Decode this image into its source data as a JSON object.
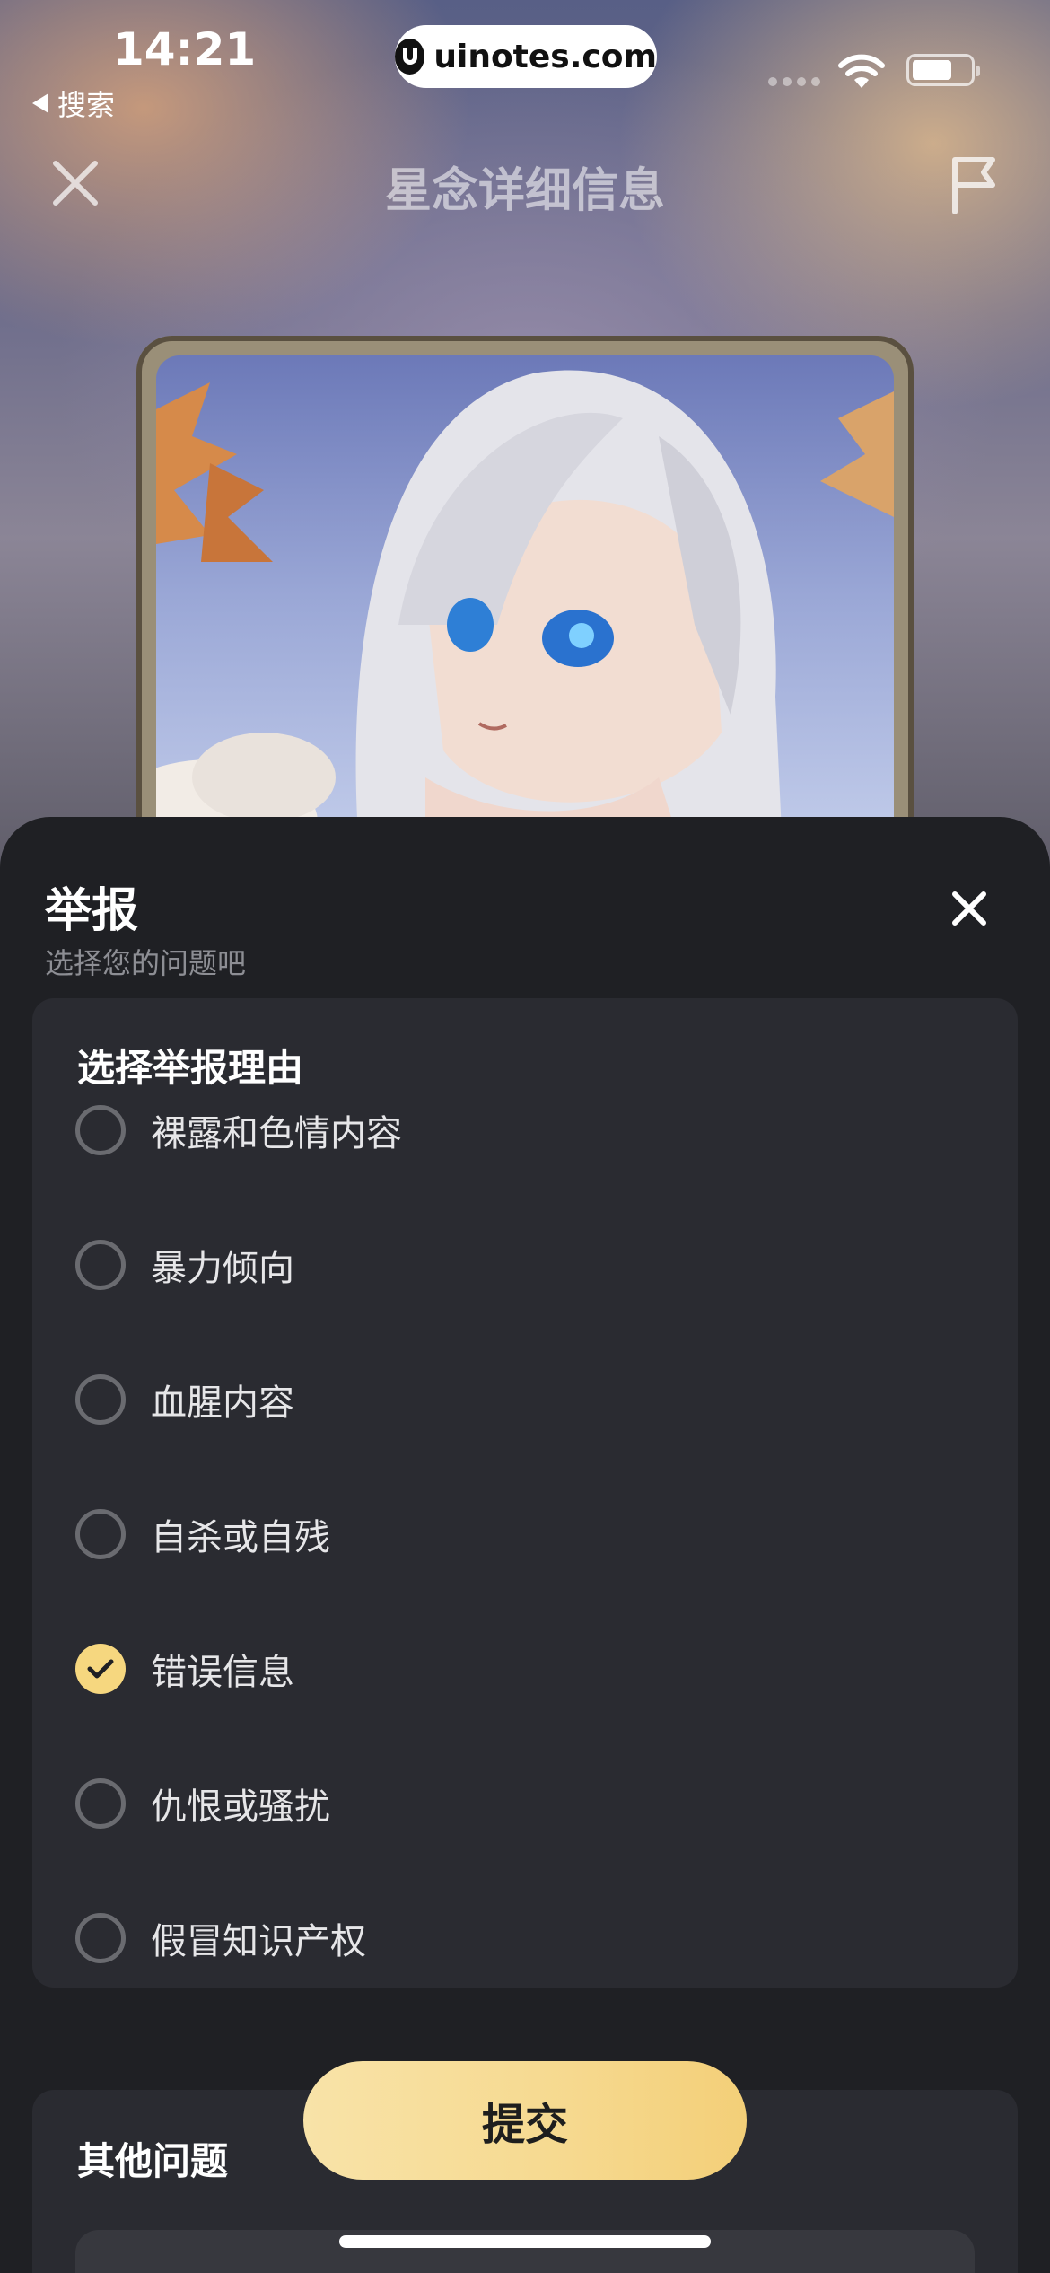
{
  "status_bar": {
    "time": "14:21",
    "back_app": "搜索",
    "url": "uinotes.com",
    "icons": [
      "signal-icon",
      "wifi-icon",
      "battery-icon"
    ]
  },
  "header": {
    "title": "星念详细信息",
    "close_icon": "close-icon",
    "report_icon": "flag-icon"
  },
  "sheet": {
    "title": "举报",
    "subtitle": "选择您的问题吧",
    "reasons_heading": "选择举报理由",
    "options": [
      {
        "label": "裸露和色情内容",
        "checked": false
      },
      {
        "label": "暴力倾向",
        "checked": false
      },
      {
        "label": "血腥内容",
        "checked": false
      },
      {
        "label": "自杀或自残",
        "checked": false
      },
      {
        "label": "错误信息",
        "checked": true
      },
      {
        "label": "仇恨或骚扰",
        "checked": false
      },
      {
        "label": "假冒知识产权",
        "checked": false
      }
    ],
    "other_heading": "其他问题",
    "submit_label": "提交"
  },
  "colors": {
    "accent": "#f6d77f",
    "sheet_bg": "#1f2024",
    "card_bg": "#2a2b31"
  }
}
